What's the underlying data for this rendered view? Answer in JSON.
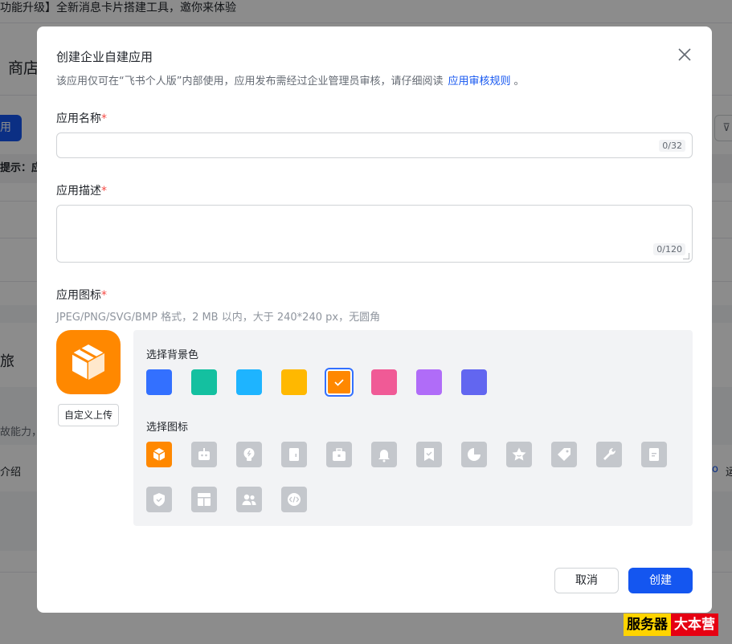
{
  "background": {
    "banner": "功能升级】全新消息卡片搭建工具，邀你来体验",
    "shop_title": "商店",
    "blue_button": "用",
    "hint_label": "提示：应",
    "side_a": "旅",
    "side_b": "故能力，",
    "side_c": "介绍",
    "side_d": "o",
    "side_e": "运"
  },
  "modal": {
    "title": "创建企业自建应用",
    "desc_main": "该应用仅可在“飞书个人版”内部使用，应用发布需经过企业管理员审核，请仔细阅读",
    "desc_link": "应用审核规则",
    "desc_end": "。"
  },
  "form": {
    "name_label": "应用名称",
    "name_value": "",
    "name_count": "0/32",
    "desc_label": "应用描述",
    "desc_value": "",
    "desc_count": "0/120",
    "icon_label": "应用图标",
    "required_mark": "*",
    "icon_hint": "JPEG/PNG/SVG/BMP 格式，2 MB 以内，大于 240*240 px，无圆角",
    "upload_button": "自定义上传"
  },
  "picker": {
    "bg_label": "选择背景色",
    "icon_label": "选择图标",
    "colors": [
      "#3370ff",
      "#14c0a0",
      "#1eb4ff",
      "#ffb800",
      "#ff8800",
      "#f05a96",
      "#b06cf8",
      "#6266f0"
    ],
    "selected_color": 4,
    "icons": [
      "cube-icon",
      "robot-icon",
      "bulb-icon",
      "door-icon",
      "briefcase-icon",
      "bell-icon",
      "bookmark-icon",
      "pie-icon",
      "star-icon",
      "tag-icon",
      "wrench-icon",
      "document-icon",
      "shield-icon",
      "layout-icon",
      "users-icon",
      "code-icon"
    ],
    "selected_icon": 0
  },
  "footer": {
    "cancel": "取消",
    "create": "创建"
  },
  "watermark": {
    "part1": "服务器",
    "part2": "大本营"
  }
}
